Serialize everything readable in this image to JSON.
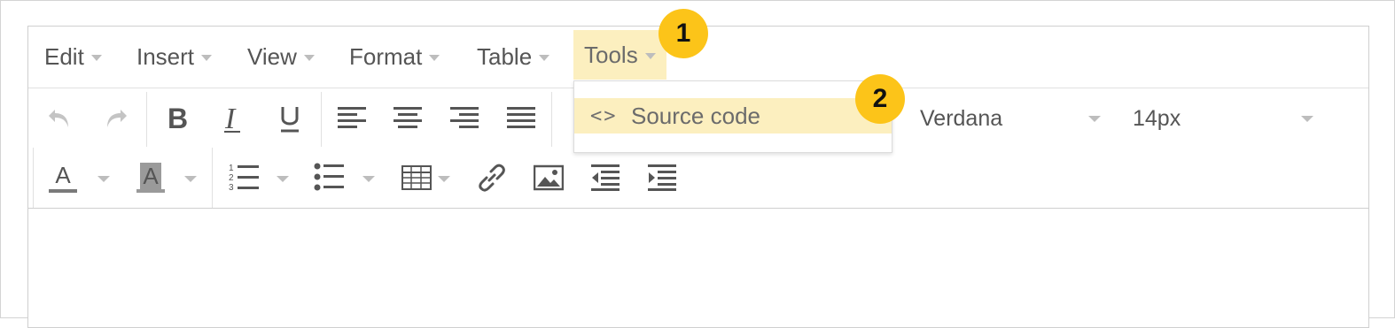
{
  "menubar": {
    "items": [
      {
        "label": "Edit"
      },
      {
        "label": "Insert"
      },
      {
        "label": "View"
      },
      {
        "label": "Format"
      },
      {
        "label": "Table"
      },
      {
        "label": "Tools",
        "active": true
      }
    ]
  },
  "toolbar": {
    "font_family": "Verdana",
    "font_size": "14px",
    "text_color_letter": "A",
    "bg_color_letter": "A"
  },
  "dropdown": {
    "items": [
      {
        "label": "Source code",
        "icon": "code-icon",
        "highlighted": true
      }
    ]
  },
  "callouts": [
    "1",
    "2"
  ],
  "colors": {
    "highlight": "#fcefbf",
    "callout": "#fcc419",
    "text_color_underline": "#7a7a7a",
    "bg_color_swatch": "#9a9a9a"
  }
}
